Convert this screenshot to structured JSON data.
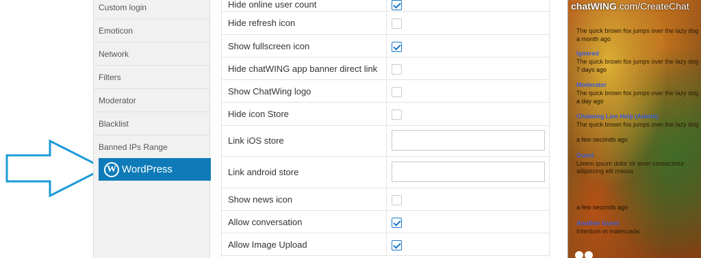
{
  "sidebar": {
    "items": [
      {
        "label": "Custom login"
      },
      {
        "label": "Emoticon"
      },
      {
        "label": "Network"
      },
      {
        "label": "Filters"
      },
      {
        "label": "Moderator"
      },
      {
        "label": "Blacklist"
      },
      {
        "label": "Banned IPs Range"
      }
    ],
    "active": {
      "label": "WordPress",
      "icon": "wordpress-icon"
    }
  },
  "settings": {
    "rows": [
      {
        "label": "Hide online user count",
        "type": "checkbox",
        "checked": true
      },
      {
        "label": "Hide refresh icon",
        "type": "checkbox",
        "checked": false
      },
      {
        "label": "Show fullscreen icon",
        "type": "checkbox",
        "checked": true
      },
      {
        "label": "Hide chatWING app banner direct link",
        "type": "checkbox",
        "checked": false
      },
      {
        "label": "Show ChatWing logo",
        "type": "checkbox",
        "checked": false
      },
      {
        "label": "Hide icon Store",
        "type": "checkbox",
        "checked": false
      },
      {
        "label": "Link iOS store",
        "type": "text",
        "value": ""
      },
      {
        "label": "Link android store",
        "type": "text",
        "value": ""
      },
      {
        "label": "Show news icon",
        "type": "checkbox",
        "checked": false
      },
      {
        "label": "Allow conversation",
        "type": "checkbox",
        "checked": true
      },
      {
        "label": "Allow Image Upload",
        "type": "checkbox",
        "checked": true
      }
    ]
  },
  "preview": {
    "title_bold": "chatWING",
    "title_rest": ".com/CreateChat",
    "messages": [
      {
        "user": "",
        "text": "The quick brown fox jumps over the lazy dog",
        "time": "a month ago"
      },
      {
        "user": "Ignored",
        "text": "The quick brown fox jumps over the lazy dog",
        "time": "7 days ago"
      },
      {
        "user": "Moderator",
        "text": "The quick brown fox jumps over the lazy dog",
        "time": "a day ago"
      },
      {
        "user": "Chatwing Live Help (Admin)",
        "text": "The quick brown fox jumps over the lazy dog",
        "time": "a few seconds ago"
      },
      {
        "user": "Guest",
        "text": "Lorem ipsum dolor sit amet consectetur adipiscing elit massa",
        "time": "a few seconds ago"
      },
      {
        "user": "Another Guest",
        "text": "Interdum et malesuada",
        "time": ""
      }
    ]
  },
  "colors": {
    "accent": "#0e7bb8",
    "checkbox": "#1a76c9",
    "arrow": "#1a9ad6"
  }
}
